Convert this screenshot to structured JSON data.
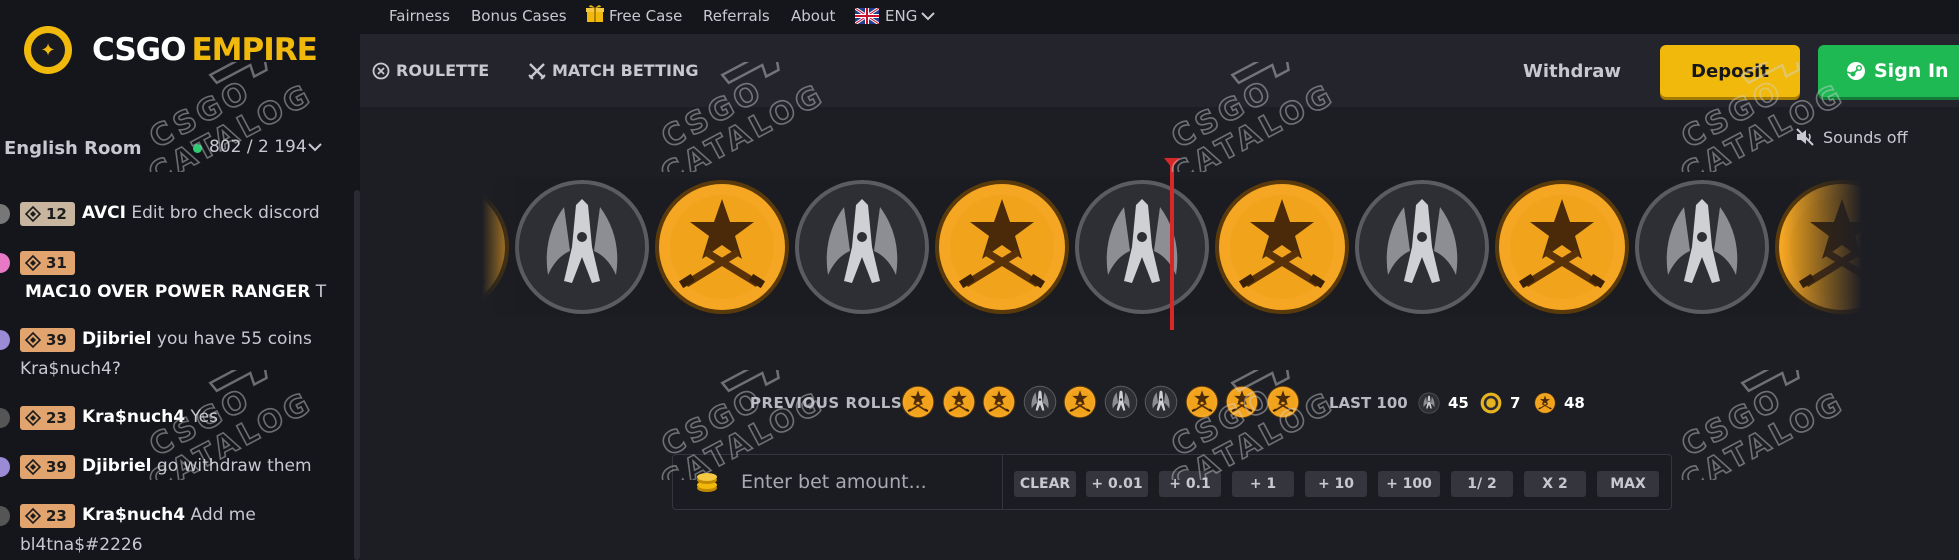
{
  "brand": {
    "name_part1": "CSGO",
    "name_part2": "EMPIRE"
  },
  "chat": {
    "room_name": "English Room",
    "online_count": "802 / 2 194",
    "messages": [
      {
        "level": "12",
        "user": "AVCI",
        "text": "Edit bro check discord",
        "text2": ""
      },
      {
        "level": "31",
        "user": "",
        "text": "",
        "text2": "MAC10 OVER POWER RANGER",
        "text2_suffix": "T"
      },
      {
        "level": "39",
        "user": "Djibriel",
        "text": "you have 55 coins",
        "text2": "Kra$nuch4?"
      },
      {
        "level": "23",
        "user": "Kra$nuch4",
        "text": "Yes",
        "text2": ""
      },
      {
        "level": "39",
        "user": "Djibriel",
        "text": "go withdraw them",
        "text2": ""
      },
      {
        "level": "23",
        "user": "Kra$nuch4",
        "text": "Add me",
        "text2": "bl4tna$#2226"
      }
    ]
  },
  "topnav": {
    "fairness": "Fairness",
    "bonus_cases": "Bonus Cases",
    "free_case": "Free Case",
    "referrals": "Referrals",
    "about": "About",
    "language": "ENG"
  },
  "header": {
    "roulette": "ROULETTE",
    "match_betting": "MATCH BETTING",
    "withdraw": "Withdraw",
    "deposit": "Deposit",
    "sign_in": "Sign In"
  },
  "game": {
    "sounds_label": "Sounds off",
    "strip": [
      "t",
      "ct",
      "t",
      "ct",
      "t",
      "ct",
      "t",
      "ct",
      "t",
      "ct",
      "t"
    ],
    "previous_rolls_label": "PREVIOUS ROLLS",
    "previous_rolls": [
      "t",
      "t",
      "t",
      "ct",
      "t",
      "ct",
      "ct",
      "t",
      "t",
      "t"
    ],
    "last100_label": "LAST 100",
    "last100": {
      "ct": "45",
      "bonus": "7",
      "t": "48"
    }
  },
  "bet": {
    "placeholder": "Enter bet amount...",
    "buttons": [
      "CLEAR",
      "+ 0.01",
      "+ 0.1",
      "+ 1",
      "+ 10",
      "+ 100",
      "1/ 2",
      "X 2",
      "MAX"
    ]
  },
  "watermark": {
    "top": "CSGO",
    "bottom": "CATALOG"
  },
  "colors": {
    "accent": "#f0b90b",
    "signin": "#1fb954",
    "marker": "#d62828",
    "level_badge": "#e2a46f"
  }
}
